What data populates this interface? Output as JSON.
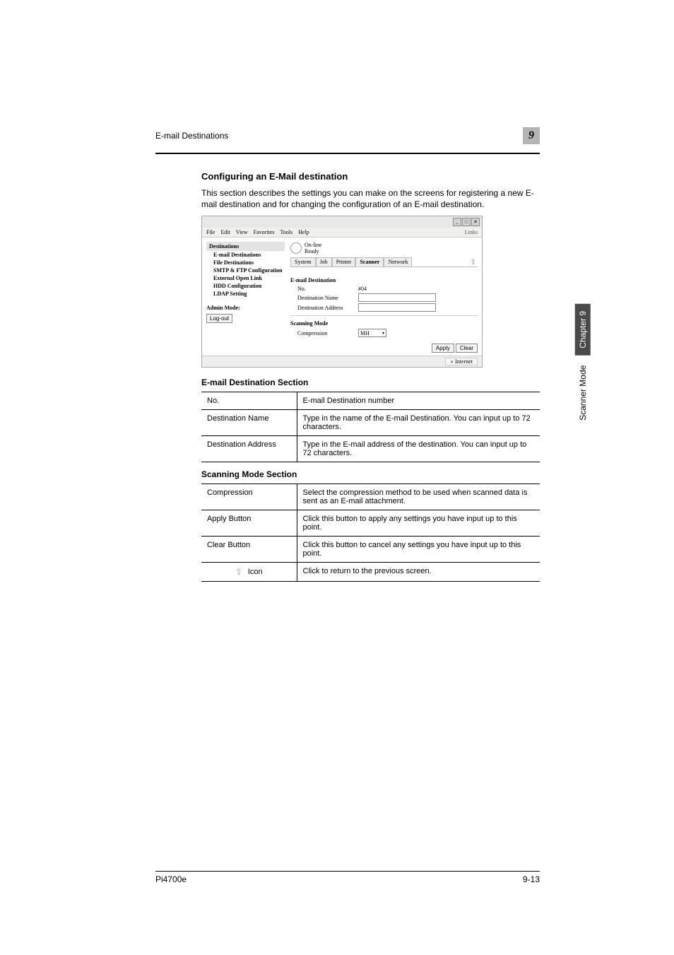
{
  "header": {
    "title": "E-mail Destinations",
    "chapter_badge": "9"
  },
  "section": {
    "heading": "Configuring an E-Mail destination",
    "intro": "This section describes the settings you can make on the screens for registering a new E-mail destination and for changing the configuration of an E-mail destination."
  },
  "screenshot": {
    "titlebar_controls": [
      "_",
      "□",
      "✕"
    ],
    "menubar": [
      "File",
      "Edit",
      "View",
      "Favorites",
      "Tools",
      "Help"
    ],
    "links_label": "Links",
    "status": {
      "line1": "On-line",
      "line2": "Ready"
    },
    "tabs": [
      "System",
      "Job",
      "Printer",
      "Scanner",
      "Network"
    ],
    "active_tab": "Scanner",
    "sidebar": {
      "title": "Destinations",
      "items": [
        {
          "label": "E-mail Destinations",
          "bold": true
        },
        {
          "label": "File Destinations",
          "bold": true
        },
        {
          "label": "SMTP & FTP Configuration",
          "bold": true
        },
        {
          "label": "External Open Link",
          "bold": true
        },
        {
          "label": "HDD Configuration",
          "bold": true
        },
        {
          "label": "LDAP Setting",
          "bold": true
        }
      ],
      "admin_label": "Admin Mode:",
      "logout_label": "Log-out"
    },
    "panel": {
      "section1_title": "E-mail Destination",
      "rows1": [
        {
          "label": "No.",
          "value": "#04"
        },
        {
          "label": "Destination Name",
          "input": true
        },
        {
          "label": "Destination Address",
          "input": true
        }
      ],
      "section2_title": "Scanning Mode",
      "rows2": [
        {
          "label": "Compression",
          "select_value": "MH"
        }
      ],
      "buttons": {
        "apply": "Apply",
        "clear": "Clear"
      },
      "up_icon": "⇪"
    },
    "statusbar": {
      "zone": "Internet",
      "globe": "●"
    }
  },
  "tables": {
    "t1": {
      "title": "E-mail Destination Section",
      "rows": [
        {
          "c1": "No.",
          "c2": "E-mail Destination number"
        },
        {
          "c1": "Destination Name",
          "c2": "Type in the name of the E-mail Destination. You can input up to 72 characters."
        },
        {
          "c1": "Destination Address",
          "c2": "Type in the E-mail address of the destination. You can input up to 72 characters."
        }
      ]
    },
    "t2": {
      "title": "Scanning Mode Section",
      "rows": [
        {
          "c1": "Compression",
          "c2": "Select the compression method to be used when scanned data is sent as an E-mail attachment."
        },
        {
          "c1": "Apply Button",
          "c2": "Click this button to apply any settings you have input up to this point."
        },
        {
          "c1": "Clear Button",
          "c2": "Click this button to cancel any settings you have input up to this point."
        },
        {
          "c1_icon": "⇪",
          "c1": "Icon",
          "c2": "Click to return to the previous screen."
        }
      ]
    }
  },
  "side_tab": {
    "mode": "Scanner Mode",
    "chapter": "Chapter 9"
  },
  "footer": {
    "left": "Pi4700e",
    "right": "9-13"
  }
}
